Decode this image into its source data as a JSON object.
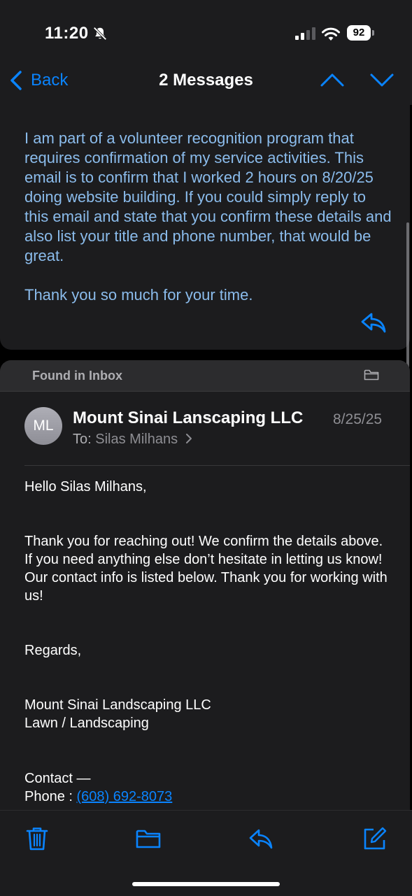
{
  "status": {
    "time": "11:20",
    "battery": "92"
  },
  "nav": {
    "back_label": "Back",
    "title": "2 Messages"
  },
  "message1": {
    "paragraph1": "I am part of a volunteer recognition program that requires confirmation of my service activities. This email is to confirm that I worked 2 hours on 8/20/25 doing website building. If you could simply reply to this email and state that you confirm these details and also list your title and phone number, that would be great.",
    "paragraph2": "Thank you so much for your time."
  },
  "message2": {
    "found_label": "Found in Inbox",
    "avatar_initials": "ML",
    "sender": "Mount Sinai Lanscaping LLC",
    "date": "8/25/25",
    "to_label": "To:",
    "to_name": "Silas Milhans",
    "greeting": "Hello Silas Milhans,",
    "body": "Thank you for reaching out! We confirm the details above. If you need anything else don’t hesitate in letting us know! Our contact info is listed below. Thank you for working with us!",
    "regards": "Regards,",
    "company": "Mount Sinai Landscaping LLC",
    "business_type": "Lawn / Landscaping",
    "contact_heading": "Contact —",
    "phone_label": "Phone :",
    "phone": "(608) 692-8073"
  },
  "colors": {
    "accent": "#0a84ff",
    "quoted_text": "#8bbcec",
    "card": "#1c1c1e"
  },
  "icons": [
    "bell-slash-icon",
    "cellular-signal-icon",
    "wifi-icon",
    "battery-icon",
    "chevron-left-icon",
    "chevron-up-icon",
    "chevron-down-icon",
    "reply-icon",
    "folder-icon",
    "disclosure-chevron-icon",
    "trash-icon",
    "compose-icon"
  ]
}
